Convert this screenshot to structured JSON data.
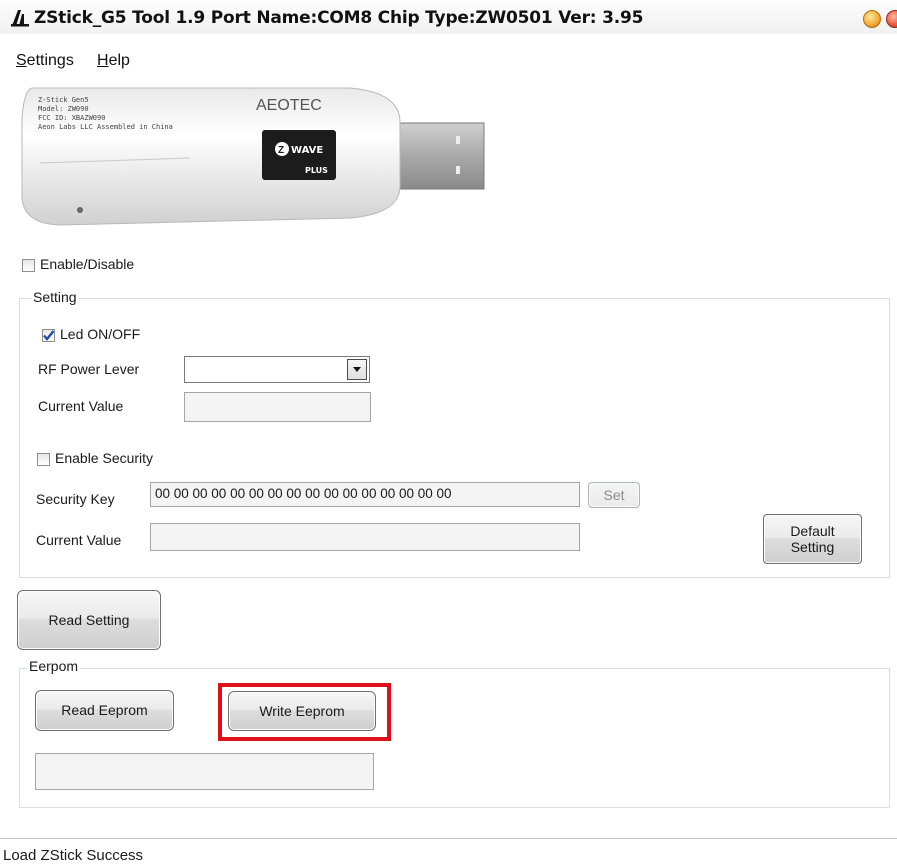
{
  "window": {
    "title": "ZStick_G5 Tool 1.9 Port Name:COM8 Chip Type:ZW0501 Ver: 3.95"
  },
  "menu": {
    "settings": {
      "accel": "S",
      "rest": "ettings"
    },
    "help": {
      "accel": "H",
      "rest": "elp"
    }
  },
  "device_image": {
    "label_lines": [
      "Z-Stick Gen5",
      "Model: ZW090",
      "FCC ID: XBAZW090",
      "Aeon Labs LLC  Assembled in China"
    ],
    "brand": "AEOTEC",
    "badge_top": "WAVE",
    "badge_bottom": "PLUS"
  },
  "enable_disable": {
    "label": "Enable/Disable",
    "checked": false
  },
  "setting_group": {
    "legend": "Setting",
    "led": {
      "label": "Led ON/OFF",
      "checked": true
    },
    "rf_power": {
      "label": "RF Power Lever",
      "value": ""
    },
    "rf_current": {
      "label": "Current Value",
      "value": ""
    },
    "enable_security": {
      "label": "Enable Security",
      "checked": false
    },
    "security_key": {
      "label": "Security Key",
      "value": "00 00 00 00 00 00 00 00 00 00 00 00 00 00 00 00"
    },
    "set_button": "Set",
    "security_current": {
      "label": "Current Value",
      "value": ""
    },
    "default_button": {
      "line1": "Default",
      "line2": "Setting"
    }
  },
  "read_setting_button": "Read Setting",
  "eeprom_group": {
    "legend": "Eerpom",
    "read_button": "Read Eeprom",
    "write_button": "Write Eeprom",
    "result_value": ""
  },
  "status": {
    "text": "Load ZStick Success"
  },
  "colors": {
    "highlight": "#e0101a",
    "checkbox_check": "#1f4fa8"
  }
}
